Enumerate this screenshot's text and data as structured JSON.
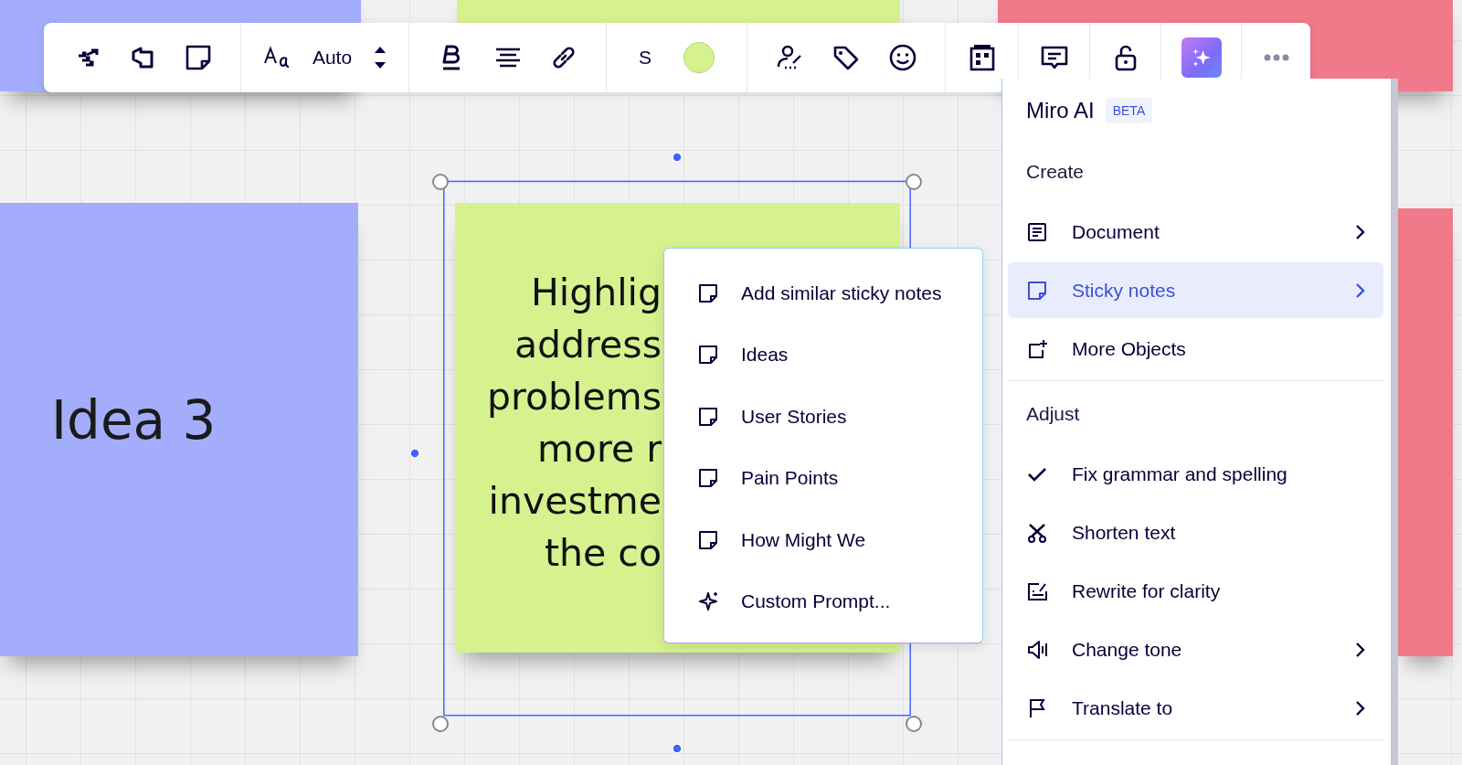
{
  "stickies": [
    {
      "color": "#a3adfb",
      "text": "Idea 3"
    },
    {
      "color": "#d6f28f",
      "lines": [
        "Highlig",
        "address",
        "problems",
        "more r",
        "investme",
        "the co"
      ]
    },
    {
      "color": "#f07a8a"
    },
    {
      "color": "#a3adfb"
    },
    {
      "color": "#d6f28f"
    },
    {
      "color": "#f07a8a"
    }
  ],
  "toolbar": {
    "font_size": "Auto",
    "text_size": "S",
    "color": "#d6f28f",
    "ai_active": true
  },
  "ai_menu": {
    "title": "Miro AI",
    "badge": "BETA",
    "sections": [
      {
        "heading": "Create",
        "items": [
          {
            "label": "Document",
            "has_submenu": true,
            "selected": false
          },
          {
            "label": "Sticky notes",
            "has_submenu": true,
            "selected": true
          },
          {
            "label": "More Objects",
            "has_submenu": false,
            "selected": false
          }
        ]
      },
      {
        "heading": "Adjust",
        "items": [
          {
            "label": "Fix grammar and spelling",
            "has_submenu": false,
            "selected": false
          },
          {
            "label": "Shorten text",
            "has_submenu": false,
            "selected": false
          },
          {
            "label": "Rewrite for clarity",
            "has_submenu": false,
            "selected": false
          },
          {
            "label": "Change tone",
            "has_submenu": true,
            "selected": false
          },
          {
            "label": "Translate to",
            "has_submenu": true,
            "selected": false
          }
        ]
      }
    ]
  },
  "sticky_submenu": [
    {
      "label": "Add similar sticky notes",
      "kind": "preset"
    },
    {
      "label": "Ideas",
      "kind": "preset"
    },
    {
      "label": "User Stories",
      "kind": "preset"
    },
    {
      "label": "Pain Points",
      "kind": "preset"
    },
    {
      "label": "How Might We",
      "kind": "preset"
    },
    {
      "label": "Custom Prompt...",
      "kind": "custom"
    }
  ]
}
